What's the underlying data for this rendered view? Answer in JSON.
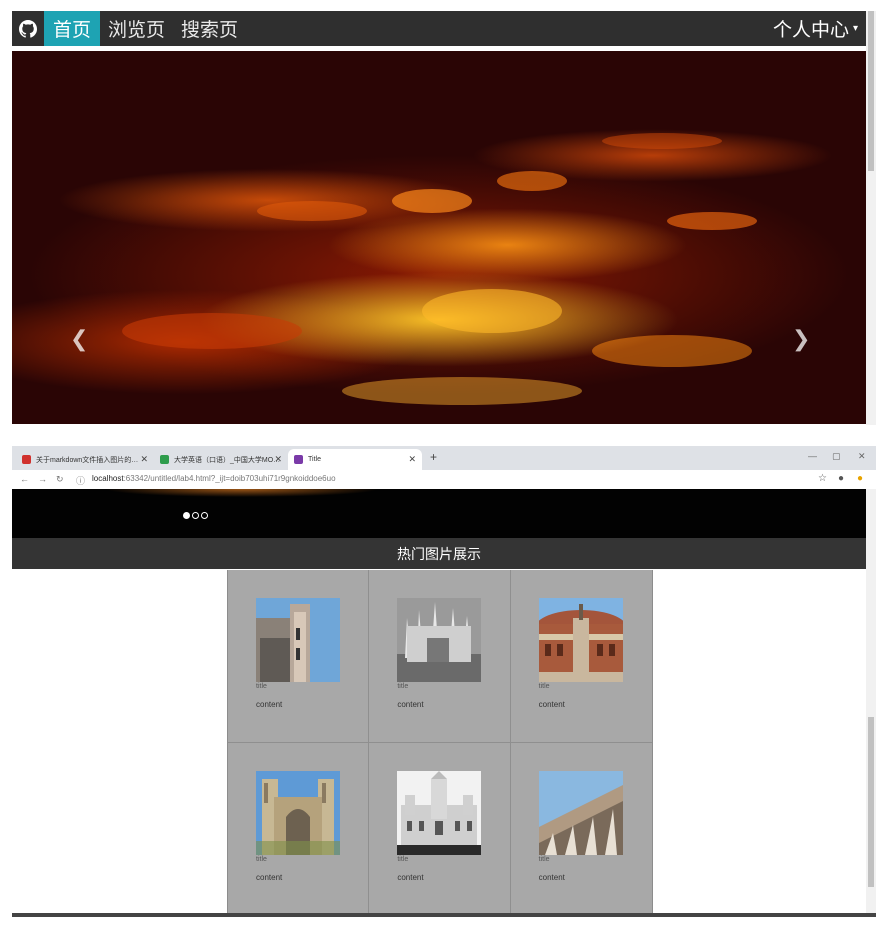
{
  "top": {
    "nav": {
      "logo_icon": "github-icon",
      "items": [
        {
          "label": "首页",
          "active": true
        },
        {
          "label": "浏览页",
          "active": false
        },
        {
          "label": "搜索页",
          "active": false
        }
      ],
      "user_menu": "个人中心",
      "active_color": "#1ea3b3"
    },
    "carousel": {
      "prev_icon": "chevron-left-icon",
      "next_icon": "chevron-right-icon"
    }
  },
  "bottom": {
    "tabs": [
      {
        "title": "关于markdown文件插入图片的…",
        "favicon_color": "#d0312d"
      },
      {
        "title": "大学英语（口语）_中国大学MO…",
        "favicon_color": "#2e9c4c"
      },
      {
        "title": "Title",
        "favicon_color": "#7a3aa8"
      }
    ],
    "url_host": "localhost",
    "url_rest": ":63342/untitled/lab4.html?_ijt=doib703uhi71r9gnkoiddoe6uo",
    "carousel_dots": 3,
    "section_title": "热门图片展示",
    "cards": [
      {
        "title": "title",
        "content": "content",
        "image": "florence-duomo"
      },
      {
        "title": "title",
        "content": "content",
        "image": "milan-cathedral"
      },
      {
        "title": "title",
        "content": "content",
        "image": "royal-albert-hall"
      },
      {
        "title": "title",
        "content": "content",
        "image": "westminster-abbey"
      },
      {
        "title": "title",
        "content": "content",
        "image": "madrid-cibeles-palace"
      },
      {
        "title": "title",
        "content": "content",
        "image": "santiago-bernabeu"
      }
    ]
  }
}
